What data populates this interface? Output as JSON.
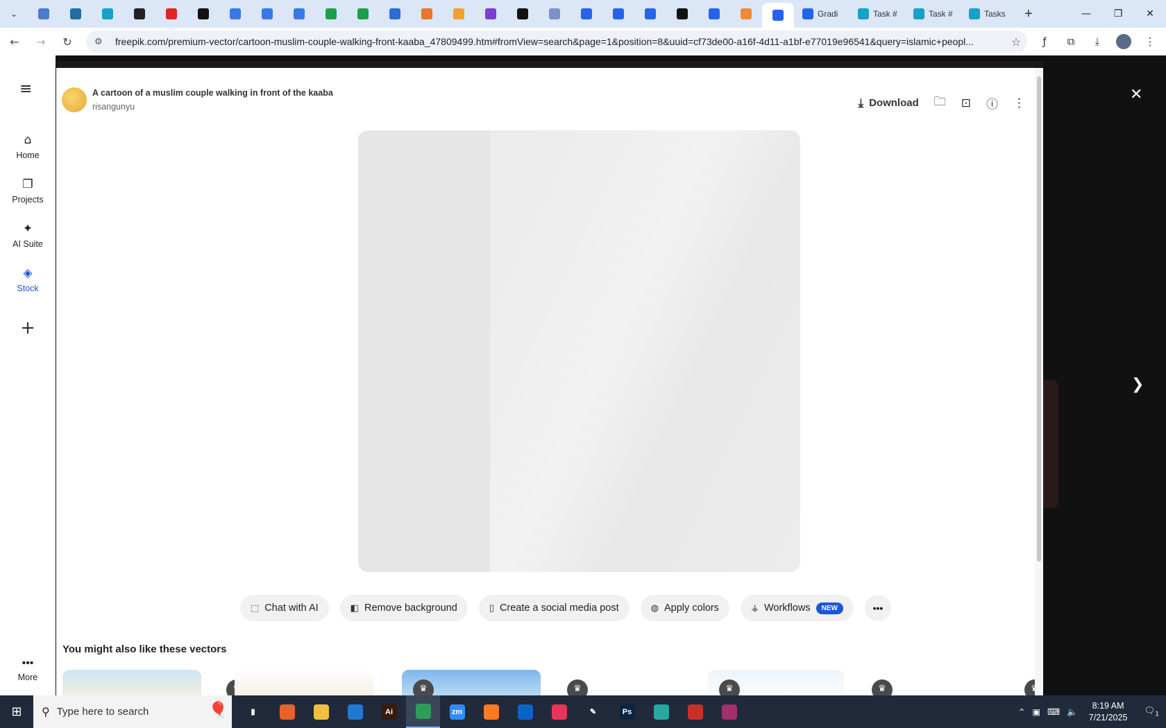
{
  "browser": {
    "pinned_tabs": [
      {
        "icon": "globe-icon",
        "color": "#4a7bd0"
      },
      {
        "icon": "shield-icon",
        "color": "#1d6fa5"
      },
      {
        "icon": "hexagon-icon",
        "color": "#18a0c8"
      },
      {
        "icon": "openai-icon",
        "color": "#222222"
      },
      {
        "icon": "youtube-icon",
        "color": "#e02424"
      },
      {
        "icon": "bolt-icon",
        "color": "#111111"
      },
      {
        "icon": "docs-icon",
        "color": "#3b78e7"
      },
      {
        "icon": "docs-icon",
        "color": "#3b78e7"
      },
      {
        "icon": "docs-icon",
        "color": "#3b78e7"
      },
      {
        "icon": "sheets-icon",
        "color": "#1e9e4a"
      },
      {
        "icon": "sheets-icon",
        "color": "#1e9e4a"
      },
      {
        "icon": "word-icon",
        "color": "#2b6cd4"
      },
      {
        "icon": "box-icon",
        "color": "#e8762d"
      },
      {
        "icon": "vee-icon",
        "color": "#f0a030"
      },
      {
        "icon": "braces-icon",
        "color": "#7a3fd0"
      },
      {
        "icon": "a-icon",
        "color": "#111111"
      },
      {
        "icon": "grid-icon",
        "color": "#7a92c8"
      },
      {
        "icon": "forms-icon",
        "color": "#2563eb"
      },
      {
        "icon": "forms-icon",
        "color": "#2563eb"
      },
      {
        "icon": "forms-icon",
        "color": "#2563eb"
      },
      {
        "icon": "m-icon",
        "color": "#111111"
      },
      {
        "icon": "forms-icon",
        "color": "#2563eb"
      },
      {
        "icon": "hand-icon",
        "color": "#f08a3a"
      },
      {
        "icon": "forms-icon",
        "color": "#2563eb"
      }
    ],
    "named_tabs": [
      {
        "label": "Gradi",
        "color": "#2563eb"
      },
      {
        "label": "Task #",
        "color": "#18a0c8"
      },
      {
        "label": "Task #",
        "color": "#18a0c8"
      },
      {
        "label": "Tasks",
        "color": "#18a0c8"
      }
    ],
    "url": "freepik.com/premium-vector/cartoon-muslim-couple-walking-front-kaaba_47809499.htm#fromView=search&page=1&position=8&uuid=cf73de00-a16f-4d11-a1bf-e77019e96541&query=islamic+peopl..."
  },
  "sidebar": {
    "items": [
      {
        "label": "Home",
        "icon": "home-icon"
      },
      {
        "label": "Projects",
        "icon": "projects-icon"
      },
      {
        "label": "AI Suite",
        "icon": "sparkles-icon"
      },
      {
        "label": "Stock",
        "icon": "stock-icon"
      }
    ],
    "more_label": "More"
  },
  "asset": {
    "title": "A cartoon of a muslim couple walking in front of the kaaba",
    "author": "risangunyu",
    "download_label": "Download"
  },
  "tools": [
    {
      "label": "Chat with AI",
      "icon": "chat-ai-icon"
    },
    {
      "label": "Remove background",
      "icon": "remove-bg-icon"
    },
    {
      "label": "Create a social media post",
      "icon": "phone-icon"
    },
    {
      "label": "Apply colors",
      "icon": "palette-icon"
    },
    {
      "label": "Workflows",
      "icon": "workflow-icon",
      "badge": "NEW"
    }
  ],
  "similar_heading": "You might also like these vectors",
  "taskbar": {
    "search_placeholder": "Type here to search",
    "time": "8:19 AM",
    "date": "7/21/2025",
    "notifications": "1",
    "apps": [
      {
        "name": "task-view-icon",
        "color": "#202a3a",
        "text": "▮"
      },
      {
        "name": "firefox-icon",
        "color": "#e8612d",
        "text": ""
      },
      {
        "name": "file-explorer-icon",
        "color": "#f0c040",
        "text": ""
      },
      {
        "name": "vscode-icon",
        "color": "#1f7ad4",
        "text": ""
      },
      {
        "name": "illustrator-icon",
        "color": "#3a1a0a",
        "text": "Ai"
      },
      {
        "name": "chrome-icon",
        "color": "#2f9d57",
        "text": ""
      },
      {
        "name": "zoom-icon",
        "color": "#2d8cff",
        "text": "zm"
      },
      {
        "name": "xampp-icon",
        "color": "#fb7a24",
        "text": ""
      },
      {
        "name": "outlook-icon",
        "color": "#0a64c8",
        "text": ""
      },
      {
        "name": "creative-cloud-icon",
        "color": "#e8345a",
        "text": ""
      },
      {
        "name": "pen-icon",
        "color": "#202a3a",
        "text": "✎"
      },
      {
        "name": "photoshop-icon",
        "color": "#0b2440",
        "text": "Ps"
      },
      {
        "name": "app-gem-icon",
        "color": "#2aa7a0",
        "text": ""
      },
      {
        "name": "app-figure-icon",
        "color": "#c8302a",
        "text": ""
      },
      {
        "name": "winrar-icon",
        "color": "#a2306e",
        "text": ""
      }
    ]
  }
}
